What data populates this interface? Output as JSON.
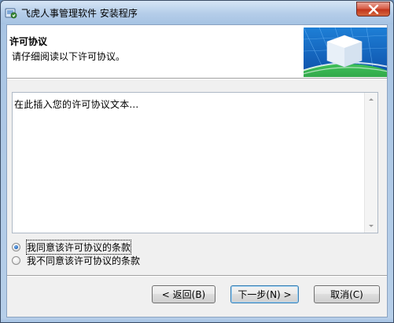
{
  "window": {
    "title": "飞虎人事管理软件 安装程序"
  },
  "header": {
    "title": "许可协议",
    "subtitle": "请仔细阅读以下许可协议。"
  },
  "license": {
    "text": "在此插入您的许可协议文本..."
  },
  "options": [
    {
      "label": "我同意该许可协议的条款",
      "checked": true
    },
    {
      "label": "我不同意该许可协议的条款",
      "checked": false
    }
  ],
  "buttons": {
    "back": "< 返回(B)",
    "next": "下一步(N) >",
    "cancel": "取消(C)"
  },
  "colors": {
    "accent": "#3c7fb1",
    "close": "#c2361c"
  }
}
